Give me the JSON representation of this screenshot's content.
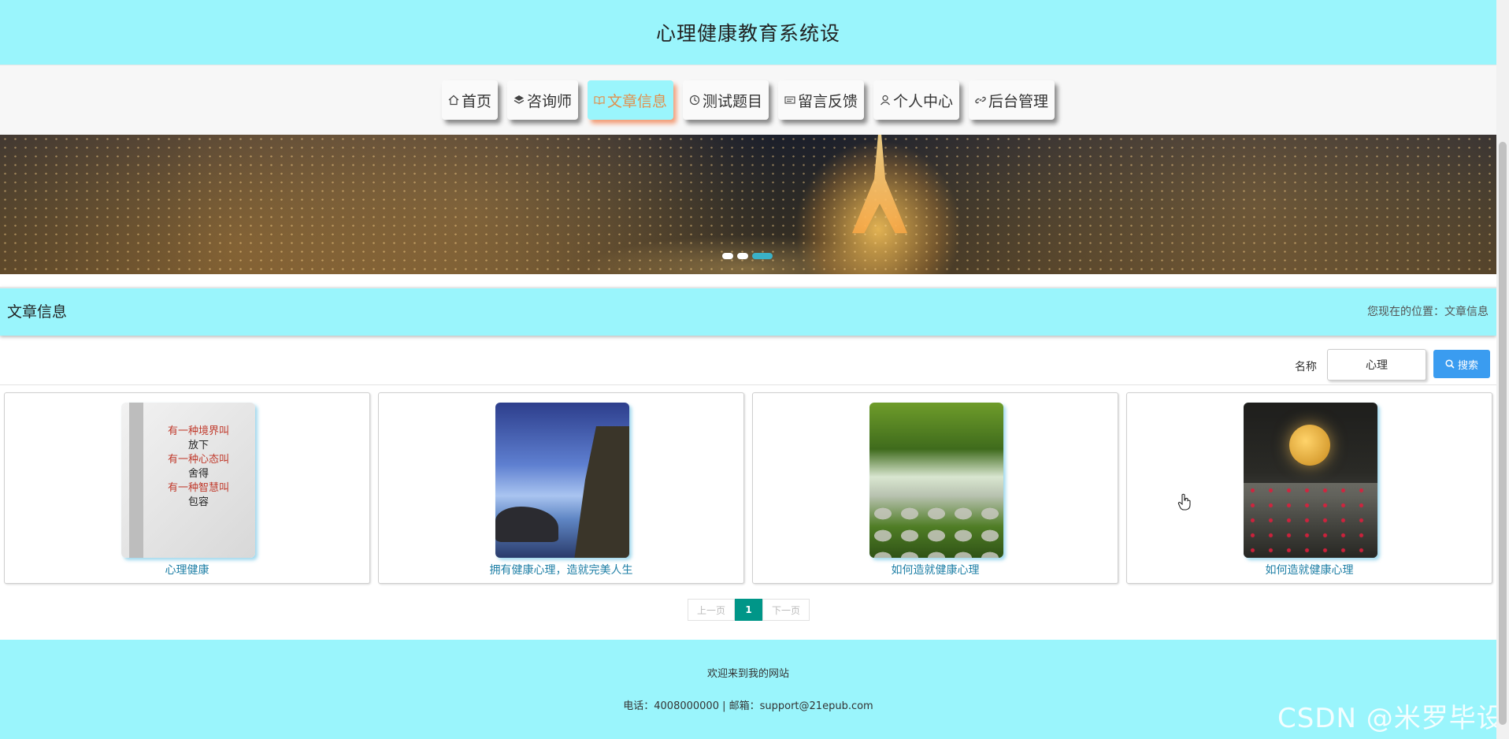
{
  "header": {
    "title": "心理健康教育系统设"
  },
  "nav": {
    "items": [
      {
        "label": "首页",
        "icon": "home-icon"
      },
      {
        "label": "咨询师",
        "icon": "layers-icon"
      },
      {
        "label": "文章信息",
        "icon": "book-icon"
      },
      {
        "label": "测试题目",
        "icon": "clock-icon"
      },
      {
        "label": "留言反馈",
        "icon": "message-icon"
      },
      {
        "label": "个人中心",
        "icon": "user-icon"
      },
      {
        "label": "后台管理",
        "icon": "link-icon"
      }
    ],
    "active_label": "文章信息"
  },
  "banner": {
    "slide_count": 3,
    "active_slide": 3
  },
  "section": {
    "title": "文章信息",
    "location_prefix": "您现在的位置：",
    "location_current": "文章信息"
  },
  "search": {
    "label": "名称",
    "value": "心理",
    "button_label": "搜索"
  },
  "articles": [
    {
      "title": "心理健康",
      "image": "book-cover"
    },
    {
      "title": "拥有健康心理，造就完美人生",
      "image": "seaside-rocks"
    },
    {
      "title": "如何造就健康心理",
      "image": "forest-stream"
    },
    {
      "title": "如何造就健康心理",
      "image": "moon-flower-field"
    }
  ],
  "book_cover": {
    "lines": [
      "有一种境界叫",
      "放下",
      "有一种心态叫",
      "舍得",
      "有一种智慧叫",
      "包容"
    ]
  },
  "pagination": {
    "prev": "上一页",
    "current": "1",
    "next": "下一页"
  },
  "footer": {
    "welcome": "欢迎来到我的网站",
    "contact": "电话：4008000000 | 邮箱：support@21epub.com"
  },
  "watermark": "CSDN @米罗毕设",
  "colors": {
    "header_bg": "#9af5fc",
    "active_nav_text": "#e0904e",
    "search_button": "#3a9cf0",
    "pager_current": "#009688",
    "link_text": "#1e7fa6"
  }
}
